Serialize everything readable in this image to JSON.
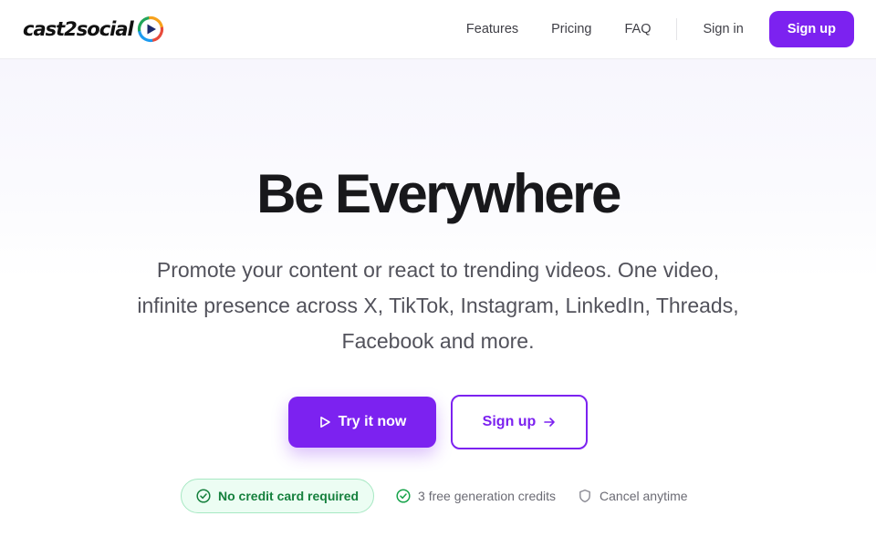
{
  "brand": {
    "name": "cast2social",
    "logo_colors": [
      "#f6a21c",
      "#e84b3c",
      "#1d9bf0",
      "#22a55a"
    ]
  },
  "nav": {
    "links": [
      "Features",
      "Pricing",
      "FAQ"
    ],
    "signin_label": "Sign in",
    "signup_label": "Sign up"
  },
  "hero": {
    "title": "Be Everywhere",
    "subtitle": "Promote your content or react to trending videos. One video, infinite presence across X, TikTok, Instagram, LinkedIn, Threads, Facebook and more.",
    "primary_cta": "Try it now",
    "secondary_cta": "Sign up",
    "trust": [
      {
        "icon": "check-circle-icon",
        "text": "No credit card required"
      },
      {
        "icon": "check-circle-icon",
        "text": "3 free generation credits"
      },
      {
        "icon": "shield-icon",
        "text": "Cancel anytime"
      }
    ]
  },
  "colors": {
    "accent": "#7c22f0",
    "success": "#15803d",
    "success_bg": "#ecfdf3"
  }
}
